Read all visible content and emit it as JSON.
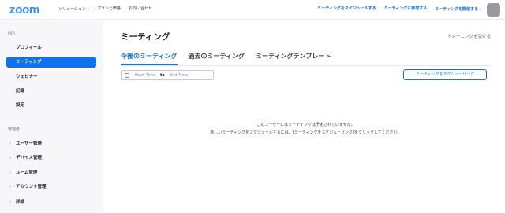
{
  "app": {
    "logo": "zoom"
  },
  "topnav": {
    "left": [
      {
        "label": "ソリューション",
        "dropdown": true
      },
      {
        "label": "プランと価格",
        "dropdown": false
      },
      {
        "label": "お問い合わせ",
        "dropdown": false
      }
    ],
    "right": [
      {
        "label": "ミーティングをスケジュールする",
        "dropdown": false
      },
      {
        "label": "ミーティングに参加する",
        "dropdown": false
      },
      {
        "label": "ミーティングを開催する",
        "dropdown": true
      }
    ]
  },
  "sidebar": {
    "personal_label": "個人",
    "personal_items": [
      {
        "label": "プロフィール",
        "active": false
      },
      {
        "label": "ミーティング",
        "active": true
      },
      {
        "label": "ウェビナー",
        "active": false
      },
      {
        "label": "記録",
        "active": false
      },
      {
        "label": "設定",
        "active": false
      }
    ],
    "admin_label": "管理者",
    "admin_items": [
      {
        "label": "ユーザー管理"
      },
      {
        "label": "デバイス管理"
      },
      {
        "label": "ルーム管理"
      },
      {
        "label": "アカウント管理"
      },
      {
        "label": "詳細"
      }
    ]
  },
  "main": {
    "title": "ミーティング",
    "training_link": "トレーニングを受ける",
    "tabs": [
      {
        "label": "今後のミーティング",
        "active": true
      },
      {
        "label": "過去のミーティング",
        "active": false
      },
      {
        "label": "ミーティングテンプレート",
        "active": false
      }
    ],
    "date_range": {
      "start_placeholder": "Start Time",
      "to": "to",
      "end_placeholder": "End Time"
    },
    "schedule_button": "ミーティングをスケジューリング",
    "empty_line1": "このユーザーにはミーティングは予定されていません。",
    "empty_line2": "新しいミーティングをスケジュールするには、[ミーティングをスケジューリング]をクリックしてください。"
  },
  "colors": {
    "accent": "#0e72ed",
    "logo": "#2d8cff",
    "sidebar_bg": "#f7f7fa"
  }
}
